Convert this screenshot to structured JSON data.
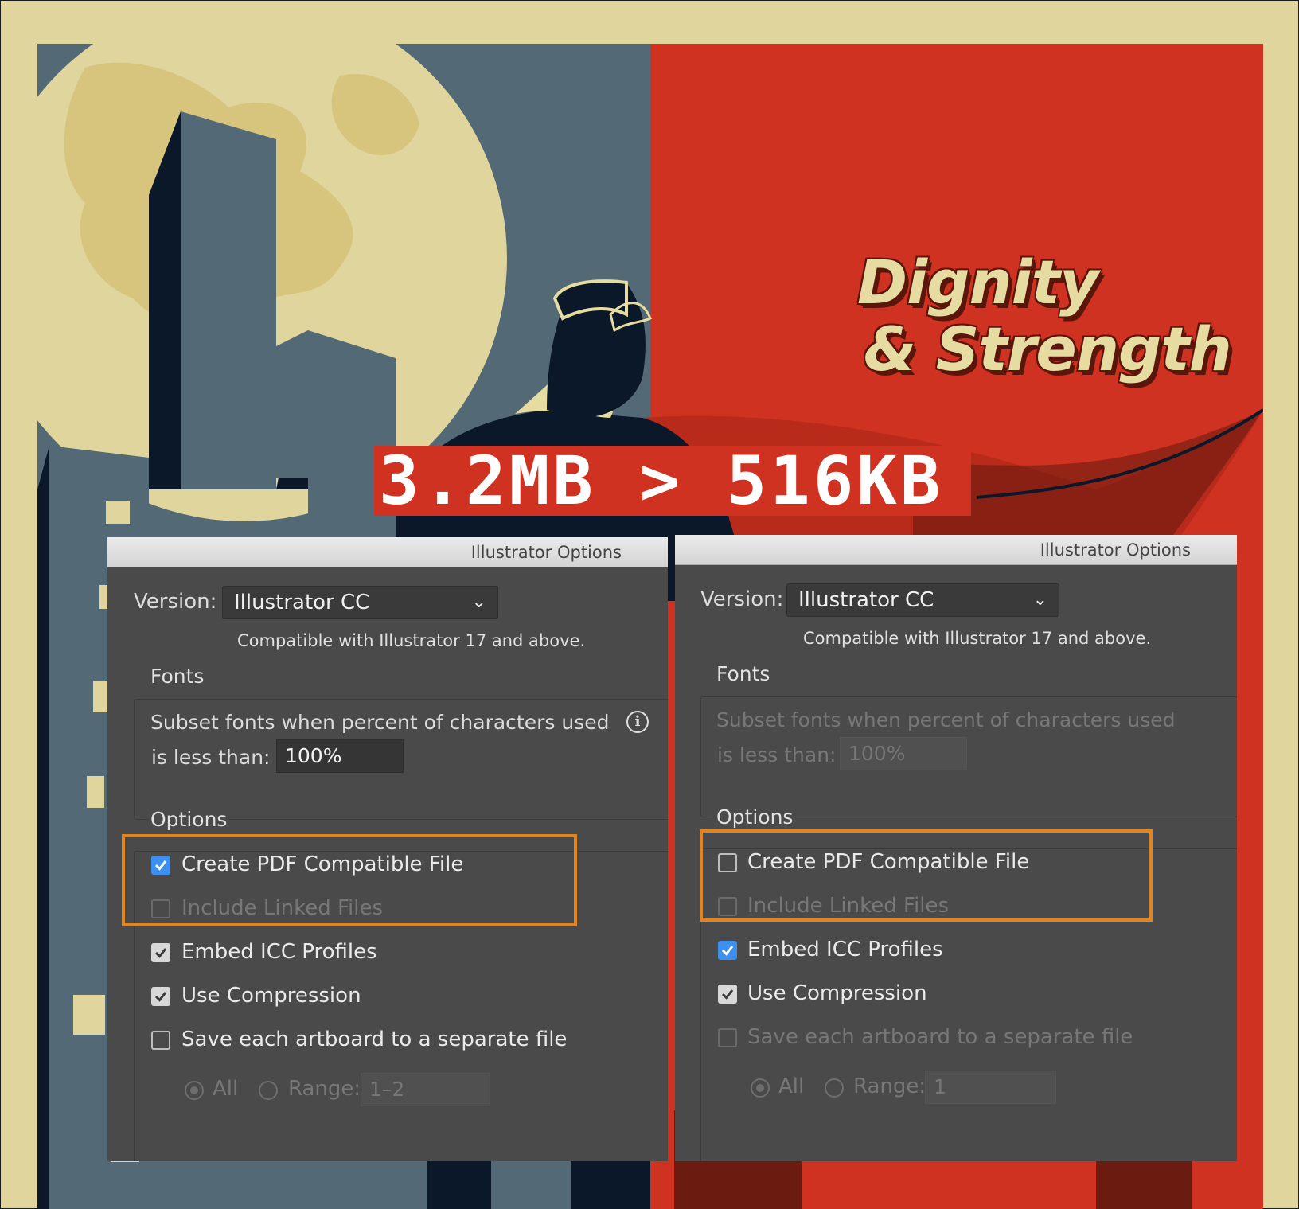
{
  "poster": {
    "headline_line1": "Dignity",
    "headline_line2": "& Strength",
    "size_comparison": "3.2MB > 516KB",
    "colors": {
      "cream": "#e0d59c",
      "slate": "#536976",
      "red": "#cf3220",
      "navy": "#0b1829",
      "dark_red": "#6b1b10"
    }
  },
  "dialogs": [
    {
      "title": "Illustrator Options",
      "version_label": "Version:",
      "version_value": "Illustrator CC",
      "compat_note": "Compatible with Illustrator 17 and above.",
      "fonts_group": "Fonts",
      "subset_text_line1": "Subset fonts when percent of characters used",
      "subset_text_line2": "is less than:",
      "subset_value": "100%",
      "options_group": "Options",
      "opt_pdf": "Create PDF Compatible File",
      "opt_linked": "Include Linked Files",
      "opt_icc": "Embed ICC Profiles",
      "opt_compression": "Use Compression",
      "opt_artboard": "Save each artboard to a separate file",
      "radio_all": "All",
      "radio_range": "Range:",
      "range_value": "1–2"
    },
    {
      "title": "Illustrator Options",
      "version_label": "Version:",
      "version_value": "Illustrator CC",
      "compat_note": "Compatible with Illustrator 17 and above.",
      "fonts_group": "Fonts",
      "subset_text_line1": "Subset fonts when percent of characters used",
      "subset_text_line2": "is less than:",
      "subset_value": "100%",
      "options_group": "Options",
      "opt_pdf": "Create PDF Compatible File",
      "opt_linked": "Include Linked Files",
      "opt_icc": "Embed ICC Profiles",
      "opt_compression": "Use Compression",
      "opt_artboard": "Save each artboard to a separate file",
      "radio_all": "All",
      "radio_range": "Range:",
      "range_value": "1"
    }
  ],
  "icons": {
    "dropdown": "chevron-down-icon",
    "info": "info-icon",
    "check": "checkmark-icon"
  }
}
